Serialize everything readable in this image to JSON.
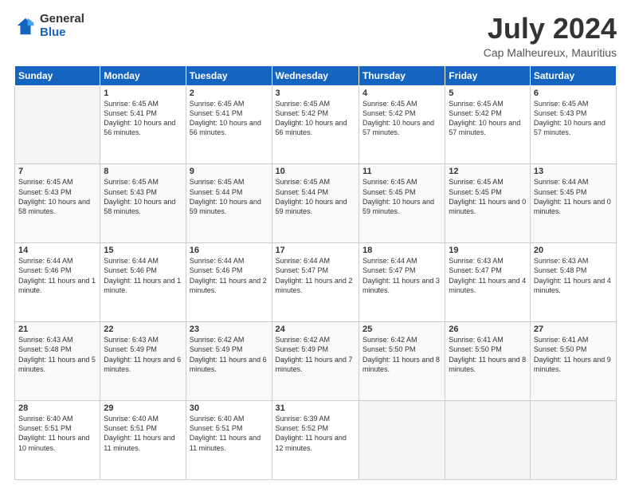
{
  "header": {
    "logo_general": "General",
    "logo_blue": "Blue",
    "main_title": "July 2024",
    "subtitle": "Cap Malheureux, Mauritius"
  },
  "calendar": {
    "days_header": [
      "Sunday",
      "Monday",
      "Tuesday",
      "Wednesday",
      "Thursday",
      "Friday",
      "Saturday"
    ],
    "weeks": [
      [
        {
          "day": "",
          "empty": true
        },
        {
          "day": "1",
          "sunrise": "Sunrise: 6:45 AM",
          "sunset": "Sunset: 5:41 PM",
          "daylight": "Daylight: 10 hours and 56 minutes."
        },
        {
          "day": "2",
          "sunrise": "Sunrise: 6:45 AM",
          "sunset": "Sunset: 5:41 PM",
          "daylight": "Daylight: 10 hours and 56 minutes."
        },
        {
          "day": "3",
          "sunrise": "Sunrise: 6:45 AM",
          "sunset": "Sunset: 5:42 PM",
          "daylight": "Daylight: 10 hours and 56 minutes."
        },
        {
          "day": "4",
          "sunrise": "Sunrise: 6:45 AM",
          "sunset": "Sunset: 5:42 PM",
          "daylight": "Daylight: 10 hours and 57 minutes."
        },
        {
          "day": "5",
          "sunrise": "Sunrise: 6:45 AM",
          "sunset": "Sunset: 5:42 PM",
          "daylight": "Daylight: 10 hours and 57 minutes."
        },
        {
          "day": "6",
          "sunrise": "Sunrise: 6:45 AM",
          "sunset": "Sunset: 5:43 PM",
          "daylight": "Daylight: 10 hours and 57 minutes."
        }
      ],
      [
        {
          "day": "7",
          "sunrise": "Sunrise: 6:45 AM",
          "sunset": "Sunset: 5:43 PM",
          "daylight": "Daylight: 10 hours and 58 minutes."
        },
        {
          "day": "8",
          "sunrise": "Sunrise: 6:45 AM",
          "sunset": "Sunset: 5:43 PM",
          "daylight": "Daylight: 10 hours and 58 minutes."
        },
        {
          "day": "9",
          "sunrise": "Sunrise: 6:45 AM",
          "sunset": "Sunset: 5:44 PM",
          "daylight": "Daylight: 10 hours and 59 minutes."
        },
        {
          "day": "10",
          "sunrise": "Sunrise: 6:45 AM",
          "sunset": "Sunset: 5:44 PM",
          "daylight": "Daylight: 10 hours and 59 minutes."
        },
        {
          "day": "11",
          "sunrise": "Sunrise: 6:45 AM",
          "sunset": "Sunset: 5:45 PM",
          "daylight": "Daylight: 10 hours and 59 minutes."
        },
        {
          "day": "12",
          "sunrise": "Sunrise: 6:45 AM",
          "sunset": "Sunset: 5:45 PM",
          "daylight": "Daylight: 11 hours and 0 minutes."
        },
        {
          "day": "13",
          "sunrise": "Sunrise: 6:44 AM",
          "sunset": "Sunset: 5:45 PM",
          "daylight": "Daylight: 11 hours and 0 minutes."
        }
      ],
      [
        {
          "day": "14",
          "sunrise": "Sunrise: 6:44 AM",
          "sunset": "Sunset: 5:46 PM",
          "daylight": "Daylight: 11 hours and 1 minute."
        },
        {
          "day": "15",
          "sunrise": "Sunrise: 6:44 AM",
          "sunset": "Sunset: 5:46 PM",
          "daylight": "Daylight: 11 hours and 1 minute."
        },
        {
          "day": "16",
          "sunrise": "Sunrise: 6:44 AM",
          "sunset": "Sunset: 5:46 PM",
          "daylight": "Daylight: 11 hours and 2 minutes."
        },
        {
          "day": "17",
          "sunrise": "Sunrise: 6:44 AM",
          "sunset": "Sunset: 5:47 PM",
          "daylight": "Daylight: 11 hours and 2 minutes."
        },
        {
          "day": "18",
          "sunrise": "Sunrise: 6:44 AM",
          "sunset": "Sunset: 5:47 PM",
          "daylight": "Daylight: 11 hours and 3 minutes."
        },
        {
          "day": "19",
          "sunrise": "Sunrise: 6:43 AM",
          "sunset": "Sunset: 5:47 PM",
          "daylight": "Daylight: 11 hours and 4 minutes."
        },
        {
          "day": "20",
          "sunrise": "Sunrise: 6:43 AM",
          "sunset": "Sunset: 5:48 PM",
          "daylight": "Daylight: 11 hours and 4 minutes."
        }
      ],
      [
        {
          "day": "21",
          "sunrise": "Sunrise: 6:43 AM",
          "sunset": "Sunset: 5:48 PM",
          "daylight": "Daylight: 11 hours and 5 minutes."
        },
        {
          "day": "22",
          "sunrise": "Sunrise: 6:43 AM",
          "sunset": "Sunset: 5:49 PM",
          "daylight": "Daylight: 11 hours and 6 minutes."
        },
        {
          "day": "23",
          "sunrise": "Sunrise: 6:42 AM",
          "sunset": "Sunset: 5:49 PM",
          "daylight": "Daylight: 11 hours and 6 minutes."
        },
        {
          "day": "24",
          "sunrise": "Sunrise: 6:42 AM",
          "sunset": "Sunset: 5:49 PM",
          "daylight": "Daylight: 11 hours and 7 minutes."
        },
        {
          "day": "25",
          "sunrise": "Sunrise: 6:42 AM",
          "sunset": "Sunset: 5:50 PM",
          "daylight": "Daylight: 11 hours and 8 minutes."
        },
        {
          "day": "26",
          "sunrise": "Sunrise: 6:41 AM",
          "sunset": "Sunset: 5:50 PM",
          "daylight": "Daylight: 11 hours and 8 minutes."
        },
        {
          "day": "27",
          "sunrise": "Sunrise: 6:41 AM",
          "sunset": "Sunset: 5:50 PM",
          "daylight": "Daylight: 11 hours and 9 minutes."
        }
      ],
      [
        {
          "day": "28",
          "sunrise": "Sunrise: 6:40 AM",
          "sunset": "Sunset: 5:51 PM",
          "daylight": "Daylight: 11 hours and 10 minutes."
        },
        {
          "day": "29",
          "sunrise": "Sunrise: 6:40 AM",
          "sunset": "Sunset: 5:51 PM",
          "daylight": "Daylight: 11 hours and 11 minutes."
        },
        {
          "day": "30",
          "sunrise": "Sunrise: 6:40 AM",
          "sunset": "Sunset: 5:51 PM",
          "daylight": "Daylight: 11 hours and 11 minutes."
        },
        {
          "day": "31",
          "sunrise": "Sunrise: 6:39 AM",
          "sunset": "Sunset: 5:52 PM",
          "daylight": "Daylight: 11 hours and 12 minutes."
        },
        {
          "day": "",
          "empty": true
        },
        {
          "day": "",
          "empty": true
        },
        {
          "day": "",
          "empty": true
        }
      ]
    ]
  }
}
